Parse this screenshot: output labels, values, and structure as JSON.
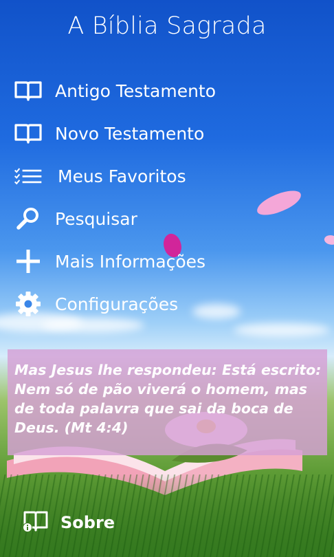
{
  "app": {
    "title": "A Bíblia Sagrada"
  },
  "menu": {
    "items": [
      {
        "label": "Antigo Testamento",
        "icon": "book-open-icon"
      },
      {
        "label": "Novo Testamento",
        "icon": "book-open-icon"
      },
      {
        "label": "Meus Favoritos",
        "icon": "checklist-icon"
      },
      {
        "label": "Pesquisar",
        "icon": "search-icon"
      },
      {
        "label": "Mais Informações",
        "icon": "plus-icon"
      },
      {
        "label": "Configurações",
        "icon": "gear-icon"
      }
    ]
  },
  "verse": {
    "text": "Mas Jesus lhe respondeu: Está escrito: Nem só de pão viverá o homem, mas de toda palavra que sai da boca de Deus.  (Mt 4:4)"
  },
  "footer": {
    "label": "Sobre",
    "icon": "book-info-icon"
  },
  "colors": {
    "verse_box": "#d6a0d6",
    "sky_top": "#1152c9",
    "grass": "#3f7d22"
  }
}
